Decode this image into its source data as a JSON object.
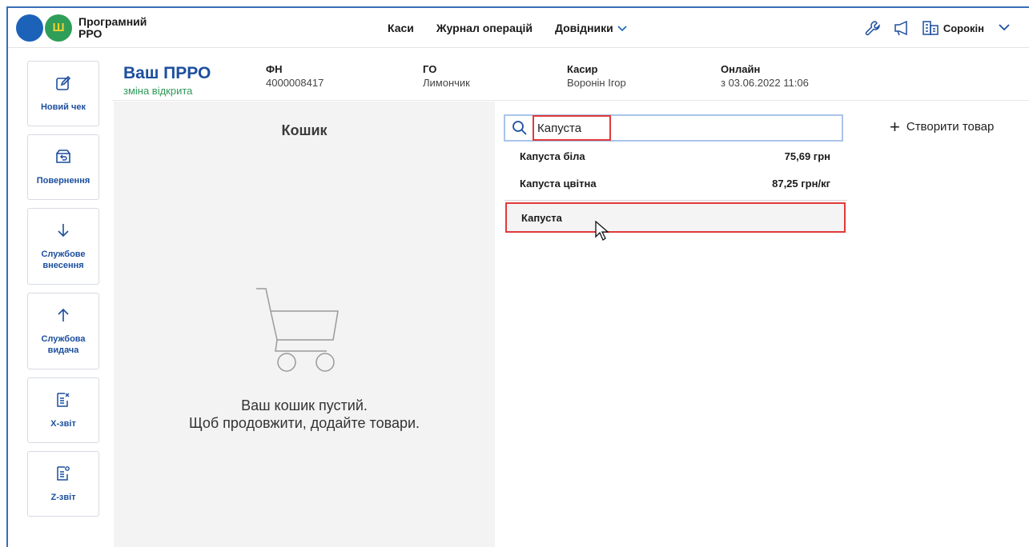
{
  "header": {
    "logo_text": "Програмний РРО",
    "nav": [
      {
        "label": "Каси"
      },
      {
        "label": "Журнал операцій"
      },
      {
        "label": "Довідники"
      }
    ],
    "user_name": "Сорокін"
  },
  "info": {
    "title": "Ваш ПРРО",
    "status": "зміна відкрита",
    "fn_label": "ФН",
    "fn_value": "4000008417",
    "go_label": "ГО",
    "go_value": "Лимончик",
    "cashier_label": "Касир",
    "cashier_value": "Воронін Ігор",
    "online_label": "Онлайн",
    "online_value": "з 03.06.2022 11:06"
  },
  "sidebar": {
    "items": [
      {
        "label": "Новий чек",
        "icon": "edit-icon"
      },
      {
        "label": "Повернення",
        "icon": "return-icon"
      },
      {
        "label": "Службове внесення",
        "icon": "arrow-down-icon"
      },
      {
        "label": "Службова видача",
        "icon": "arrow-up-icon"
      },
      {
        "label": "X-звіт",
        "icon": "x-report-icon"
      },
      {
        "label": "Z-звіт",
        "icon": "z-report-icon"
      }
    ]
  },
  "basket": {
    "title": "Кошик",
    "empty_line1": "Ваш кошик пустий.",
    "empty_line2": "Щоб продовжити, додайте товари."
  },
  "search": {
    "value": "Капуста",
    "results": [
      {
        "name": "Капуста біла",
        "price": "75,69 грн"
      },
      {
        "name": "Капуста цвітна",
        "price": "87,25 грн/кг"
      }
    ],
    "create_option": "Капуста"
  },
  "create_product_label": "Створити товар",
  "colors": {
    "brand_blue": "#1c4f9e",
    "status_green": "#2e9a57",
    "highlight_red": "#e03a3a"
  }
}
